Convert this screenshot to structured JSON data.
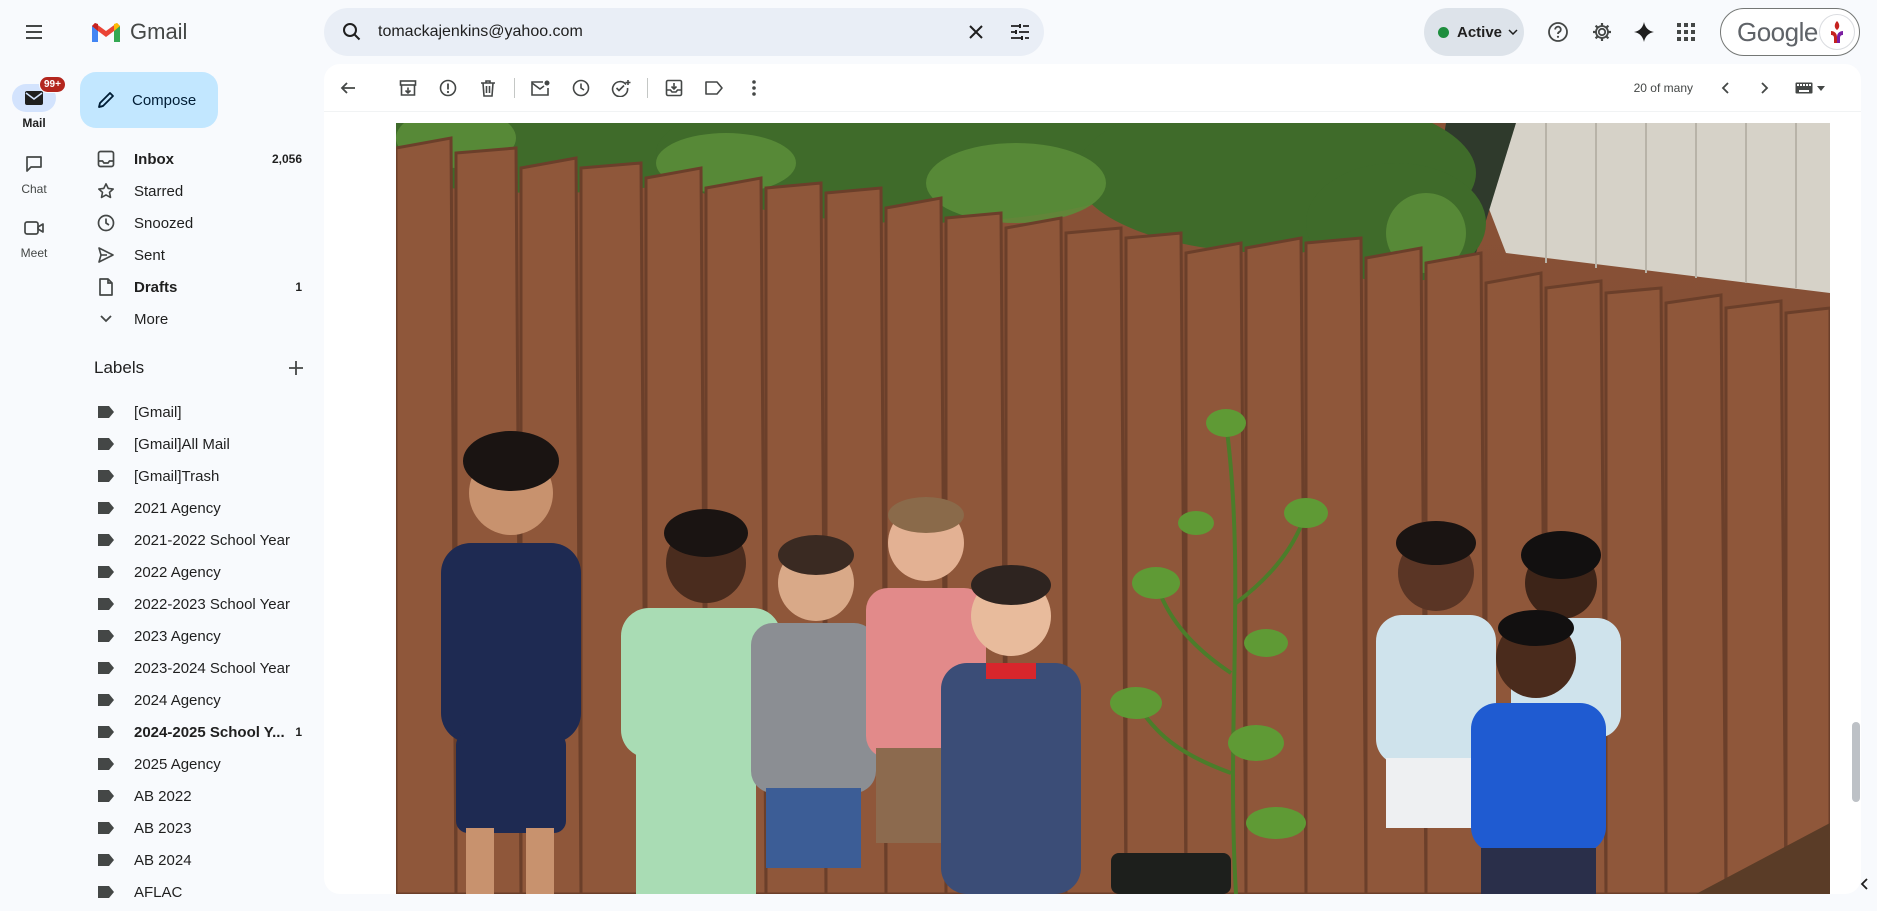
{
  "app": {
    "logo_text": "Gmail",
    "colors": {
      "accent": "#0b57d0",
      "compose_bg": "#c2e7ff",
      "status_green": "#1e8e3e",
      "badge_red": "#b3261e"
    }
  },
  "rail": {
    "items": [
      {
        "label": "Mail",
        "badge": "99+",
        "icon": "mail-icon"
      },
      {
        "label": "Chat",
        "icon": "chat-icon"
      },
      {
        "label": "Meet",
        "icon": "video-icon"
      }
    ]
  },
  "search": {
    "query": "tomackajenkins@yahoo.com"
  },
  "header": {
    "status_label": "Active",
    "account_text": "Google"
  },
  "sidebar": {
    "compose_label": "Compose",
    "nav": [
      {
        "label": "Inbox",
        "count": "2,056",
        "icon": "inbox-icon"
      },
      {
        "label": "Starred",
        "count": "",
        "icon": "star-icon"
      },
      {
        "label": "Snoozed",
        "count": "",
        "icon": "clock-icon"
      },
      {
        "label": "Sent",
        "count": "",
        "icon": "send-icon"
      },
      {
        "label": "Drafts",
        "count": "1",
        "icon": "draft-icon"
      },
      {
        "label": "More",
        "count": "",
        "icon": "chevron-down-icon"
      }
    ],
    "labels_heading": "Labels",
    "labels": [
      {
        "label": "[Gmail]",
        "count": ""
      },
      {
        "label": "[Gmail]All Mail",
        "count": ""
      },
      {
        "label": "[Gmail]Trash",
        "count": ""
      },
      {
        "label": "2021 Agency",
        "count": ""
      },
      {
        "label": "2021-2022 School Year",
        "count": ""
      },
      {
        "label": "2022 Agency",
        "count": ""
      },
      {
        "label": "2022-2023 School Year",
        "count": ""
      },
      {
        "label": "2023 Agency",
        "count": ""
      },
      {
        "label": "2023-2024 School Year",
        "count": ""
      },
      {
        "label": "2024 Agency",
        "count": ""
      },
      {
        "label": "2024-2025 School Y...",
        "count": "1"
      },
      {
        "label": "2025 Agency",
        "count": ""
      },
      {
        "label": "AB 2022",
        "count": ""
      },
      {
        "label": "AB 2023",
        "count": ""
      },
      {
        "label": "AB 2024",
        "count": ""
      },
      {
        "label": "AFLAC",
        "count": ""
      }
    ]
  },
  "toolbar": {
    "pager_text": "20 of many"
  },
  "message": {
    "image_icon": "photo-icon"
  }
}
